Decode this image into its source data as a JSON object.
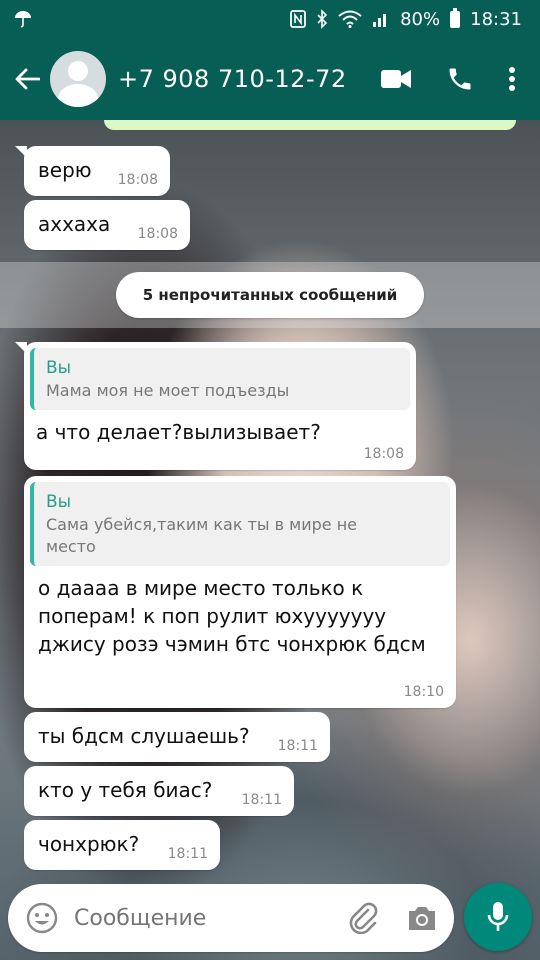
{
  "status_bar": {
    "battery": "80%",
    "time": "18:31"
  },
  "header": {
    "contact": "+7 908 710-12-72"
  },
  "chat": {
    "unread_banner": "5 непрочитанных сообщений",
    "messages": [
      {
        "text": "верю",
        "time": "18:08"
      },
      {
        "text": "аххаха",
        "time": "18:08"
      },
      {
        "quote_author": "Вы",
        "quote_text": "Мама моя не моет подъезды",
        "text": "а что делает?вылизывает?",
        "time": "18:08"
      },
      {
        "quote_author": "Вы",
        "quote_text": "Сама убейся,таким как ты в мире не место",
        "text": "о даааа в мире место только к\nпоперам! к поп рулит юхууууууу\nджису розэ чэмин бтс чонхрюк бдсм",
        "time": "18:10"
      },
      {
        "text": "ты бдсм слушаешь?",
        "time": "18:11"
      },
      {
        "text": "кто у тебя биас?",
        "time": "18:11"
      },
      {
        "text": "чонхрюк?",
        "time": "18:11"
      }
    ]
  },
  "input": {
    "placeholder": "Сообщение"
  },
  "colors": {
    "primary": "#075e54",
    "accent": "#00897b",
    "quote_author": "#2a9d8a"
  },
  "icons": [
    "umbrella-icon",
    "nfc-icon",
    "bluetooth-icon",
    "wifi-icon",
    "signal-icon",
    "battery-icon",
    "back-arrow-icon",
    "video-call-icon",
    "phone-icon",
    "more-vert-icon",
    "emoji-icon",
    "attach-icon",
    "camera-icon",
    "mic-icon"
  ]
}
